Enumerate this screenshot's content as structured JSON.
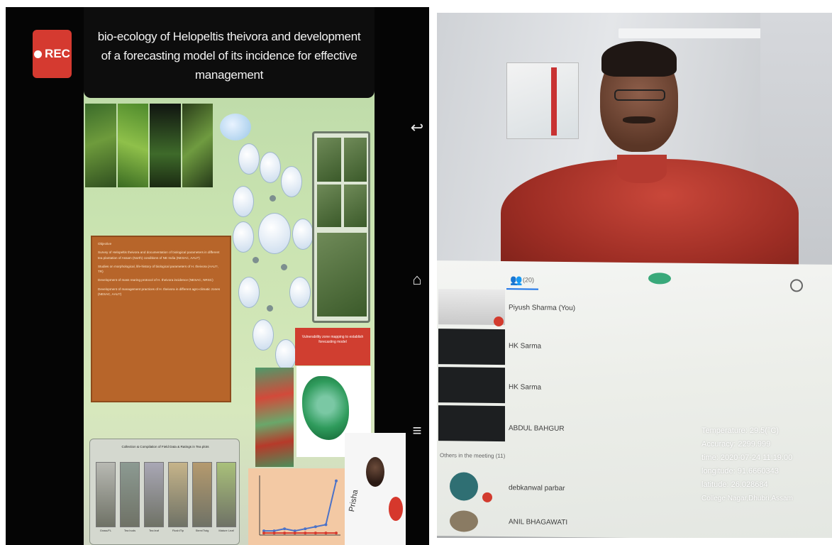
{
  "recording": {
    "label": "REC"
  },
  "slide": {
    "title_line1": "bio-ecology of Helopeltis theivora and development",
    "title_line2": "of a forecasting model of its incidence for effective management",
    "objectives_label": "Objective",
    "objectives": [
      "Survey of Helopeltis theivora and documentation of biological parameters in different tea plantation of Assam (North) conditions of NE India (NESAC, AAU?)",
      "Studies on morphological, life-history of biological parameters of H. theivora (AAU?, TR)",
      "Development of mass rearing protocol of H. theivora incidence (NESAC, NRSC)",
      "Development of management practices of H. theivora in different agro-climatic zones (NESAC, AAU?)"
    ],
    "red_box_text": "Vulnerability zone mapping to establish forecasting model",
    "collection_title": "Collection & Compilation of Field Data & Ratings in Tea plots",
    "sample_labels": [
      "Grass/FL",
      "Tea buds",
      "Tea leaf",
      "Flush/Tip",
      "Stem/Twig",
      "Mature Leaf"
    ],
    "presenter_name": "Prisha",
    "sample_colors": [
      "#b8b9b3",
      "#8c9a92",
      "#a9a7b5",
      "#c6b48a",
      "#b59a6e",
      "#a9c07a"
    ]
  },
  "tablet_nav": {
    "back": "↩",
    "home": "⌂",
    "recent": "≡"
  },
  "people_panel": {
    "tab_label": "(20)",
    "participants": [
      {
        "name": "Piyush Sharma (You)"
      },
      {
        "name": "HK Sarma"
      },
      {
        "name": "HK Sarma"
      },
      {
        "name": "ABDUL BAHGUR"
      }
    ],
    "others_header": "Others in the meeting (11)",
    "others": [
      {
        "name": "debkanwal parbar"
      },
      {
        "name": "ANIL BHAGAWATI"
      }
    ]
  },
  "geo_overlay": {
    "temperature": "Temperature:   29.5(°C)",
    "accuracy": "Accuracy:   2299.999",
    "time": "time:   2020-07-24 11:19:00",
    "longitude": "longitude:   91.6660343",
    "latitude": "latitude:   26.028684",
    "location": "College Nagar,Dhubri,Assam"
  },
  "chart_data": {
    "type": "line",
    "title": "",
    "xlabel": "",
    "ylabel": "",
    "series": [
      {
        "values": [
          0.2,
          0.2,
          0.3,
          0.2,
          0.3,
          0.4,
          0.5,
          2.6
        ]
      },
      {
        "values": [
          0.1,
          0.1,
          0.1,
          0.1,
          0.1,
          0.1,
          0.1,
          0.1
        ]
      }
    ],
    "colors": [
      "#4b72c8",
      "#d63a2e"
    ]
  }
}
